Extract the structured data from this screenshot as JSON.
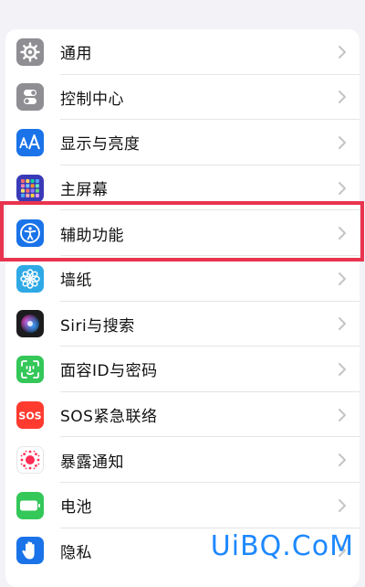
{
  "settings": {
    "items": [
      {
        "label": "通用",
        "icon": "gear-icon",
        "color": "#8e8e93"
      },
      {
        "label": "控制中心",
        "icon": "toggles-icon",
        "color": "#8e8e93"
      },
      {
        "label": "显示与亮度",
        "icon": "text-size-icon",
        "color": "#1a73e8"
      },
      {
        "label": "主屏幕",
        "icon": "app-grid-icon",
        "color": "#3a3ab8"
      },
      {
        "label": "辅助功能",
        "icon": "accessibility-icon",
        "color": "#1a73e8"
      },
      {
        "label": "墙纸",
        "icon": "flower-icon",
        "color": "#2ea9e6"
      },
      {
        "label": "Siri与搜索",
        "icon": "siri-icon",
        "color": "#1c1c1e"
      },
      {
        "label": "面容ID与密码",
        "icon": "face-id-icon",
        "color": "#34c759"
      },
      {
        "label": "SOS紧急联络",
        "icon": "sos-icon",
        "color": "#ff3b30"
      },
      {
        "label": "暴露通知",
        "icon": "exposure-icon",
        "color": "#ffffff"
      },
      {
        "label": "电池",
        "icon": "battery-icon",
        "color": "#34c759"
      },
      {
        "label": "隐私",
        "icon": "hand-icon",
        "color": "#1a73e8"
      }
    ],
    "highlighted_item": "辅助功能"
  },
  "watermark": {
    "text": "UiBQ.CoM",
    "color": "#1e88ff"
  }
}
